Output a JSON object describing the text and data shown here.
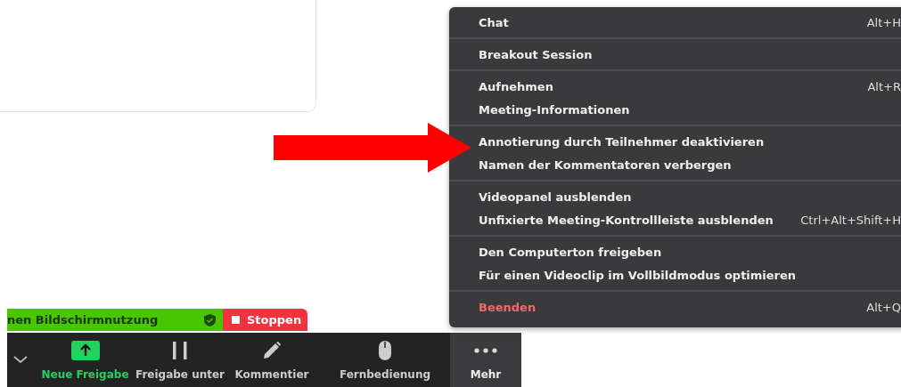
{
  "share_banner": {
    "text": "nen Bildschirmnutzung",
    "stop_button": "Stoppen"
  },
  "toolbar": [
    {
      "kind": "caret",
      "selected": false
    },
    {
      "kind": "share",
      "label": "Neue Freigabe",
      "selected": false
    },
    {
      "kind": "pause",
      "label": "Freigabe unter",
      "selected": false
    },
    {
      "kind": "annotate",
      "label": "Kommentier",
      "selected": false
    },
    {
      "kind": "remote",
      "label": "Fernbedienung",
      "selected": false
    },
    {
      "kind": "more",
      "label": "Mehr",
      "selected": true
    }
  ],
  "menu": {
    "groups": [
      [
        {
          "label": "Chat",
          "shortcut": "Alt+H",
          "kind": "normal"
        }
      ],
      [
        {
          "label": "Breakout Session",
          "kind": "normal"
        }
      ],
      [
        {
          "label": "Aufnehmen",
          "shortcut": "Alt+R",
          "kind": "normal"
        },
        {
          "label": "Meeting-Informationen",
          "kind": "normal"
        }
      ],
      [
        {
          "label": "Annotierung durch Teilnehmer deaktivieren",
          "kind": "normal"
        },
        {
          "label": "Namen der Kommentatoren verbergen",
          "kind": "normal"
        }
      ],
      [
        {
          "label": "Videopanel ausblenden",
          "kind": "normal"
        },
        {
          "label": "Unfixierte Meeting-Kontrollleiste ausblenden",
          "shortcut": "Ctrl+Alt+Shift+H",
          "kind": "normal"
        }
      ],
      [
        {
          "label": "Den Computerton freigeben",
          "kind": "normal"
        },
        {
          "label": "Für einen Videoclip im Vollbildmodus optimieren",
          "kind": "normal"
        }
      ],
      [
        {
          "label": "Beenden",
          "shortcut": "Alt+Q",
          "kind": "danger"
        }
      ]
    ]
  }
}
